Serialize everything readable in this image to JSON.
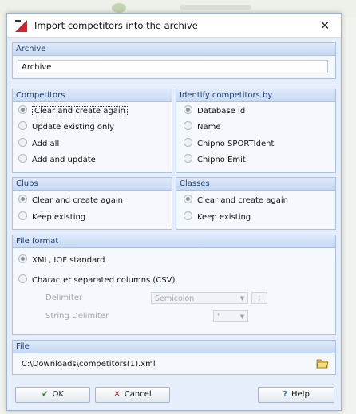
{
  "dialog": {
    "title": "Import competitors into the archive",
    "close_glyph": "✕"
  },
  "archive": {
    "header": "Archive",
    "value": "Archive"
  },
  "competitors": {
    "header": "Competitors",
    "options": [
      "Clear and create again",
      "Update existing only",
      "Add all",
      "Add and update"
    ],
    "selected": 0
  },
  "identify": {
    "header": "Identify competitors by",
    "options": [
      "Database Id",
      "Name",
      "Chipno SPORTIdent",
      "Chipno Emit"
    ],
    "selected": 0
  },
  "clubs": {
    "header": "Clubs",
    "options": [
      "Clear and create again",
      "Keep existing"
    ],
    "selected": 0
  },
  "classes": {
    "header": "Classes",
    "options": [
      "Clear and create again",
      "Keep existing"
    ],
    "selected": 0
  },
  "file_format": {
    "header": "File format",
    "options": [
      "XML, IOF standard",
      "Character separated columns (CSV)"
    ],
    "selected": 0,
    "delimiter_label": "Delimiter",
    "delimiter_value": "Semicolon",
    "delimiter_char": ";",
    "string_delimiter_label": "String Delimiter",
    "string_delimiter_value": "\""
  },
  "file": {
    "header": "File",
    "path": "C:\\Downloads\\competitors(1).xml"
  },
  "buttons": {
    "ok": "OK",
    "cancel": "Cancel",
    "help": "Help"
  },
  "colors": {
    "header_text": "#1e3d6c",
    "ok_check": "#1f8a1f",
    "cancel_x": "#c81e1e",
    "help_icon": "#2c6fd1"
  }
}
